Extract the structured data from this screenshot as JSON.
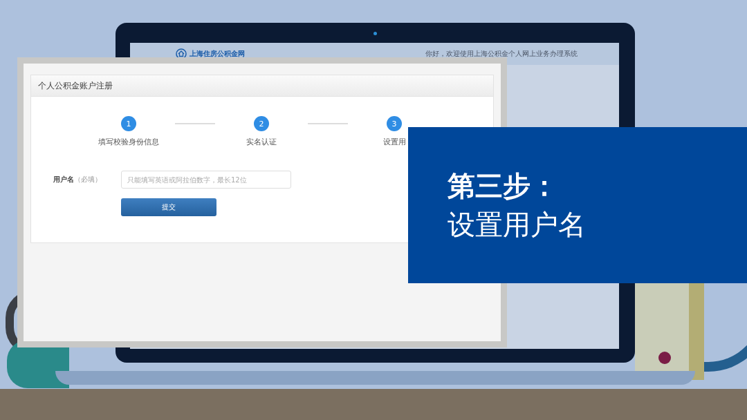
{
  "site_header": {
    "logo_text": "上海住房公积金网",
    "welcome": "你好，欢迎使用上海公积金个人网上业务办理系统"
  },
  "form_panel": {
    "title": "个人公积金账户注册",
    "steps": [
      {
        "number": "1",
        "label": "填写校验身份信息"
      },
      {
        "number": "2",
        "label": "实名认证"
      },
      {
        "number": "3",
        "label": "设置用"
      }
    ],
    "field": {
      "label": "用户名",
      "hint": "（必填）",
      "placeholder": "只能填写英语或阿拉伯数字，最长12位"
    },
    "submit_button": "提交"
  },
  "callout": {
    "heading": "第三步：",
    "subheading": "设置用户名"
  }
}
